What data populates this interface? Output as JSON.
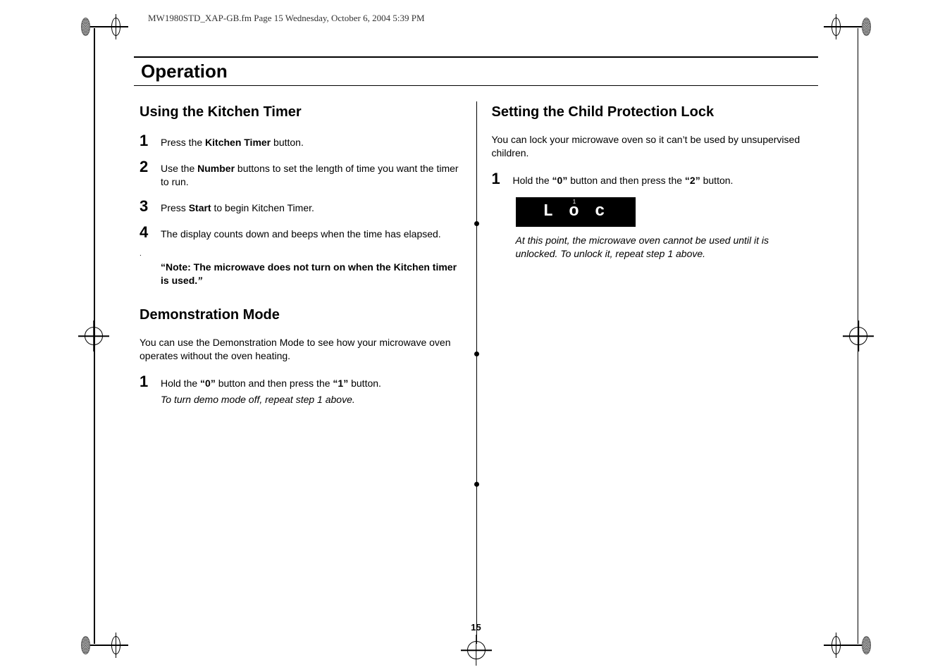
{
  "running_head": "MW1980STD_XAP-GB.fm  Page 15  Wednesday, October 6, 2004  5:39 PM",
  "heading": "Operation",
  "page_number": "15",
  "left": {
    "section1_title": "Using the Kitchen Timer",
    "s1_step1_a": "Press the ",
    "s1_step1_b": "Kitchen Timer",
    "s1_step1_c": " button.",
    "s1_step2_a": "Use the ",
    "s1_step2_b": "Number",
    "s1_step2_c": " buttons to set the length of time you want the timer to run.",
    "s1_step3_a": "Press ",
    "s1_step3_b": "Start",
    "s1_step3_c": " to begin Kitchen Timer.",
    "s1_step4": "The display counts down and beeps when the time has elapsed.",
    "s1_note": "Note: The microwave does not turn on when the Kitchen timer is used.",
    "section2_title": "Demonstration Mode",
    "s2_intro": "You can use the Demonstration Mode to see how your microwave oven operates without the oven heating.",
    "s2_step1_a": "Hold the ",
    "s2_step1_b": "“0”",
    "s2_step1_c": " button and then press the ",
    "s2_step1_d": "“1”",
    "s2_step1_e": " button.",
    "s2_step1_note": "To turn demo mode off, repeat step 1 above."
  },
  "right": {
    "section_title": "Setting the Child Protection Lock",
    "intro": "You can lock your microwave oven so it can’t be used by unsupervised children.",
    "step1_a": "Hold the ",
    "step1_b": "“0”",
    "step1_c": " button and then press the ",
    "step1_d": "“2”",
    "step1_e": " button.",
    "display_text": "L o c",
    "display_icons": "1",
    "caption": "At this point, the microwave oven cannot be used until it is unlocked. To unlock it, repeat step 1 above."
  },
  "nums": {
    "n1": "1",
    "n2": "2",
    "n3": "3",
    "n4": "4"
  }
}
